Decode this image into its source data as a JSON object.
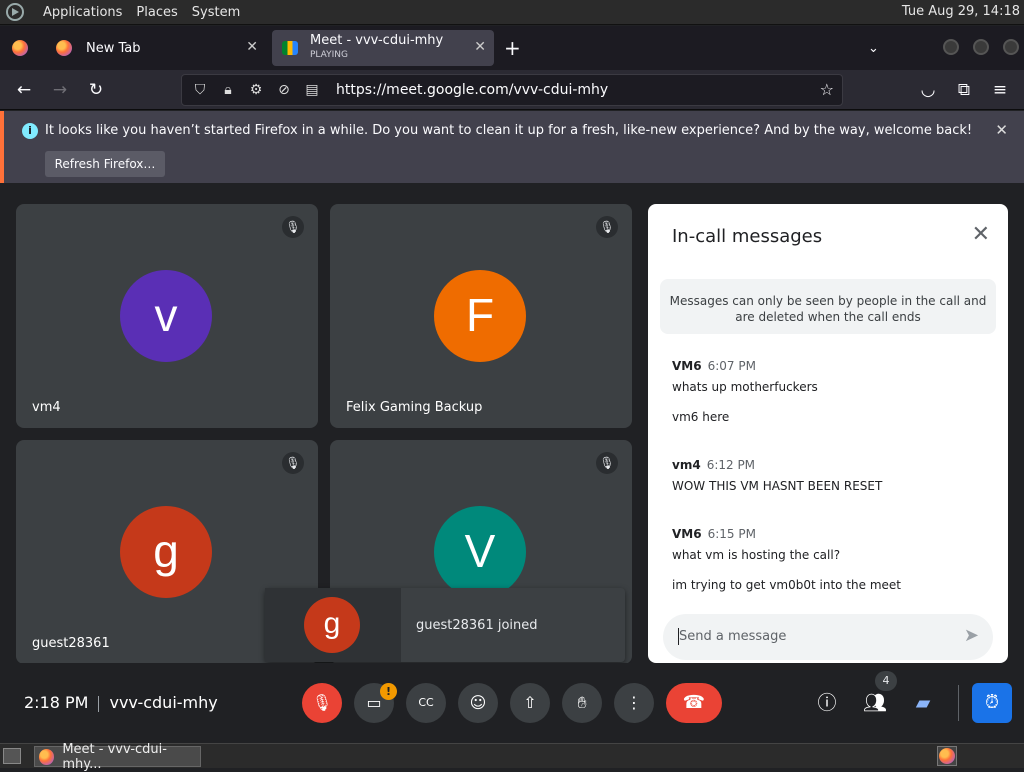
{
  "system_panel": {
    "menus": [
      "Applications",
      "Places",
      "System"
    ],
    "clock": "Tue Aug 29, 14:18"
  },
  "browser": {
    "tabs": [
      {
        "label": "New Tab",
        "sublabel": ""
      },
      {
        "label": "Meet - vvv-cdui-mhy",
        "sublabel": "PLAYING"
      }
    ],
    "new_tab_symbol": "+",
    "url_host_prefix": "https://meet.",
    "url_host": "google.com",
    "url_path": "/vvv-cdui-mhy"
  },
  "notification": {
    "message": "It looks like you haven’t started Firefox in a while. Do you want to clean it up for a fresh, like-new experience? And by the way, welcome back!",
    "button": "Refresh Firefox…"
  },
  "tiles": [
    {
      "name": "vm4",
      "initial": "v",
      "color": "#5a2fb5"
    },
    {
      "name": "Felix Gaming Backup",
      "initial": "F",
      "color": "#ef6c00"
    },
    {
      "name": "guest28361",
      "initial": "g",
      "color": "#c5391a"
    },
    {
      "name": "",
      "initial": "V",
      "color": "#00897b"
    }
  ],
  "toast": {
    "initial": "g",
    "text": "guest28361 joined"
  },
  "chat": {
    "title": "In-call messages",
    "notice_line1": "Messages can only be seen by people in the call and",
    "notice_line2": "are deleted when the call ends",
    "groups": [
      {
        "sender": "VM6",
        "time": "6:07 PM",
        "messages": [
          "whats up motherfuckers",
          "vm6 here"
        ]
      },
      {
        "sender": "vm4",
        "time": "6:12 PM",
        "messages": [
          "WOW THIS VM HASNT BEEN RESET"
        ]
      },
      {
        "sender": "VM6",
        "time": "6:15 PM",
        "messages": [
          "what vm is hosting the call?",
          "im trying to get vm0b0t into the meet"
        ]
      }
    ],
    "input_placeholder": "Send a message"
  },
  "bottom_bar": {
    "time": "2:18 PM",
    "meeting_code": "vvv-cdui-mhy",
    "people_count": "4",
    "camera_warning": "!"
  },
  "taskbar": {
    "task_label": "Meet - vvv-cdui-mhy..."
  },
  "colors": {
    "end_call": "#ea4335",
    "accent_blue": "#1a73e8",
    "meet_bg": "#202124",
    "tile_bg": "#3c4043"
  }
}
